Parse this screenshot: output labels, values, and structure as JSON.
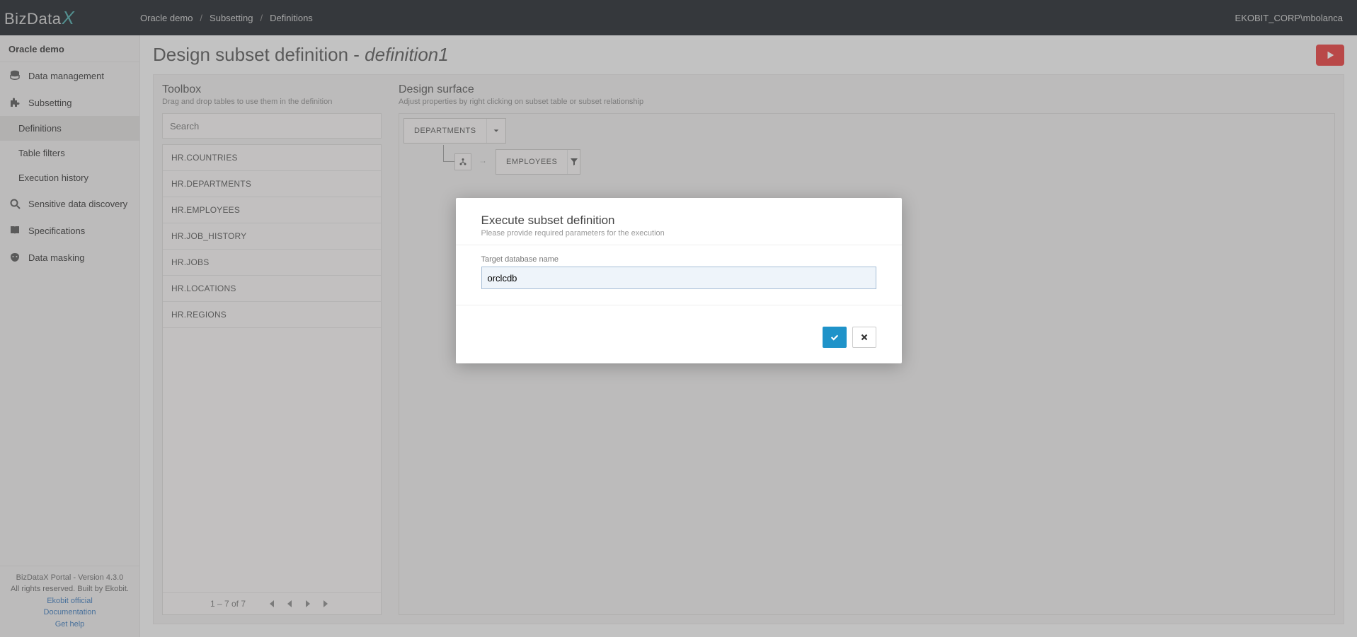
{
  "brand": {
    "name": "BizData",
    "suffix": "X"
  },
  "user": "EKOBIT_CORP\\mbolanca",
  "breadcrumb": [
    "Oracle demo",
    "Subsetting",
    "Definitions"
  ],
  "env_title": "Oracle demo",
  "nav": {
    "data_mgmt": "Data management",
    "subsetting": "Subsetting",
    "subsetting_children": {
      "definitions": "Definitions",
      "table_filters": "Table filters",
      "exec_history": "Execution history"
    },
    "discovery": "Sensitive data discovery",
    "specifications": "Specifications",
    "masking": "Data masking"
  },
  "footer": {
    "line1": "BizDataX Portal - Version 4.3.0",
    "line2": "All rights reserved. Built by Ekobit.",
    "links": {
      "official": "Ekobit official",
      "docs": "Documentation",
      "help": "Get help"
    }
  },
  "page": {
    "title_prefix": "Design subset definition - ",
    "title_name": "definition1"
  },
  "toolbox": {
    "title": "Toolbox",
    "subtitle": "Drag and drop tables to use them in the definition",
    "search_placeholder": "Search",
    "tables": [
      "HR.COUNTRIES",
      "HR.DEPARTMENTS",
      "HR.EMPLOYEES",
      "HR.JOB_HISTORY",
      "HR.JOBS",
      "HR.LOCATIONS",
      "HR.REGIONS"
    ],
    "pager_range": "1 – 7 of 7"
  },
  "surface": {
    "title": "Design surface",
    "subtitle": "Adjust properties by right clicking on subset table or subset relationship",
    "node1": "DEPARTMENTS",
    "node2": "EMPLOYEES"
  },
  "modal": {
    "title": "Execute subset definition",
    "subtitle": "Please provide required parameters for the execution",
    "field_label": "Target database name",
    "field_value": "orclcdb"
  }
}
